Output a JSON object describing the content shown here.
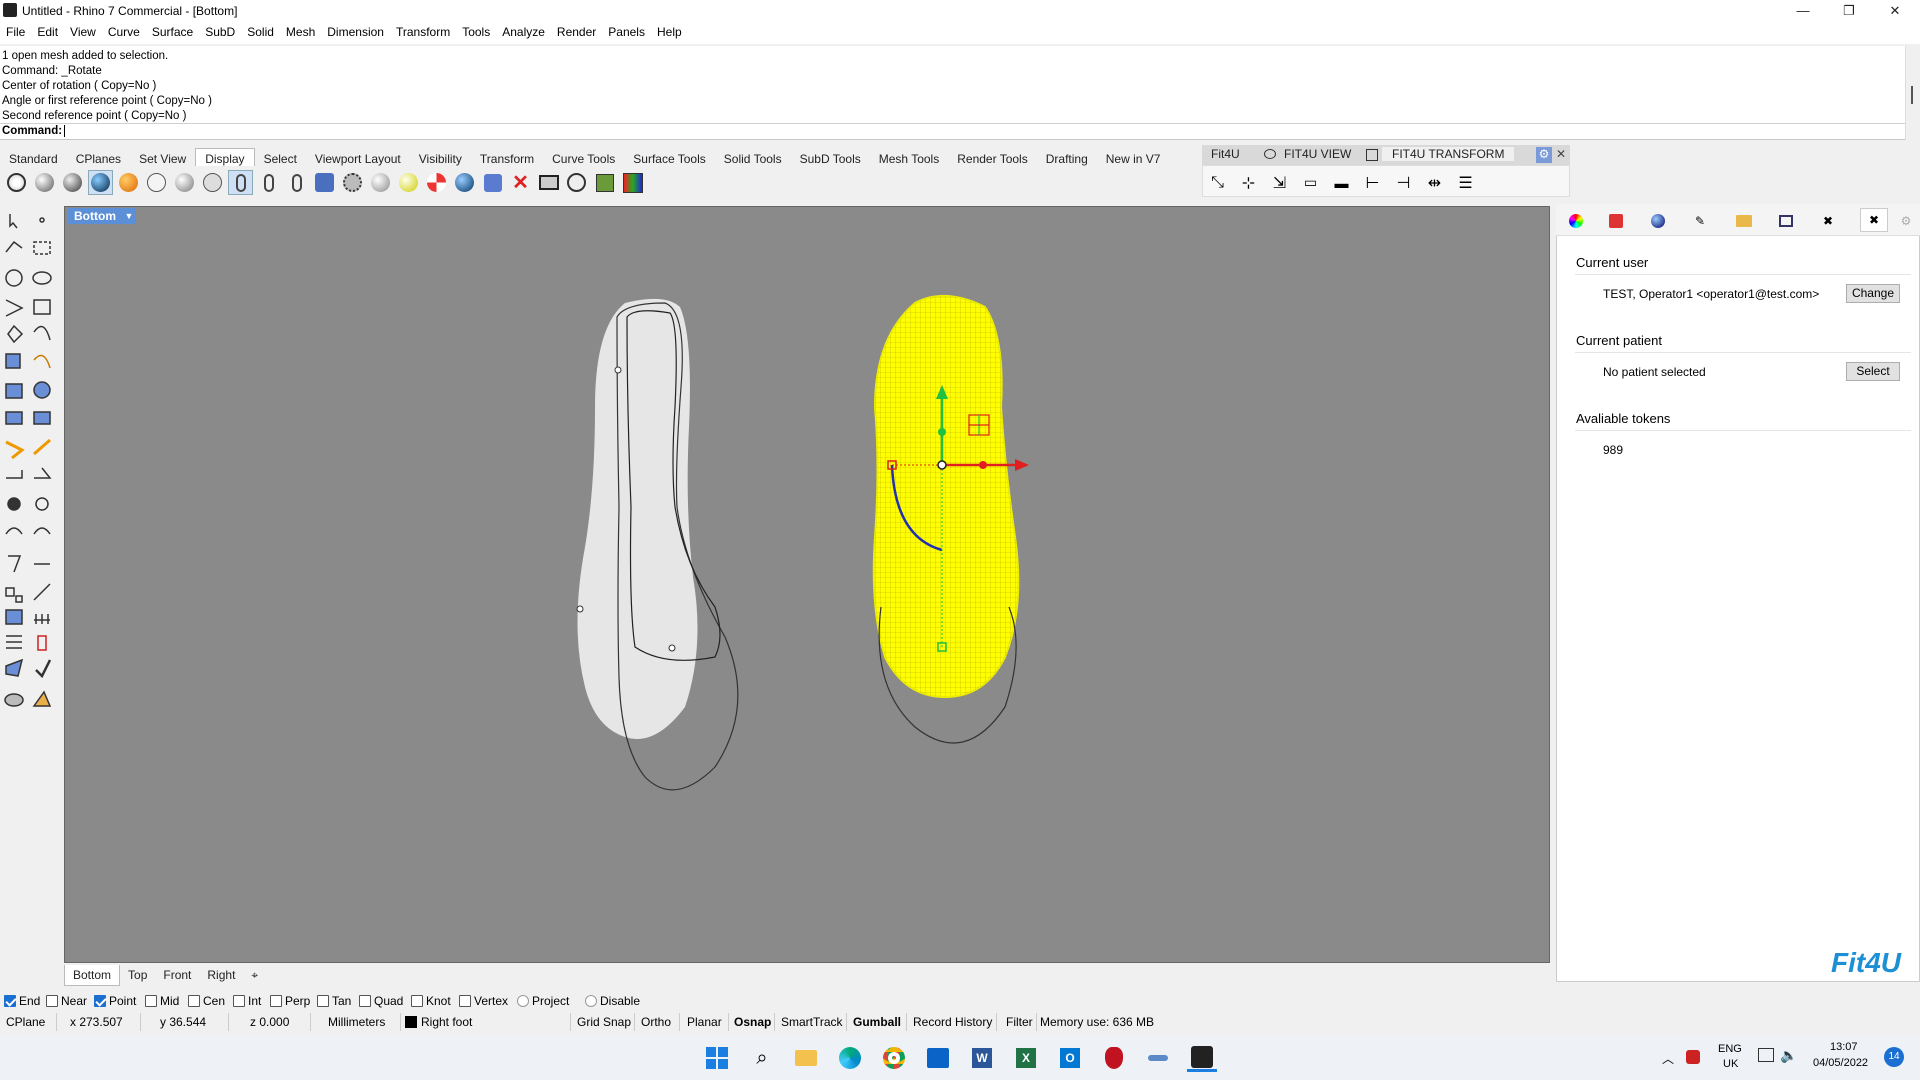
{
  "window": {
    "title": "Untitled - Rhino 7 Commercial - [Bottom]",
    "min": "—",
    "max": "❐",
    "close": "✕"
  },
  "menu": [
    "File",
    "Edit",
    "View",
    "Curve",
    "Surface",
    "SubD",
    "Solid",
    "Mesh",
    "Dimension",
    "Transform",
    "Tools",
    "Analyze",
    "Render",
    "Panels",
    "Help"
  ],
  "history": [
    "1 open mesh added to selection.",
    "Command: _Rotate",
    "Center of rotation ( Copy=No )",
    "Angle or first reference point ( Copy=No )",
    "Second reference point ( Copy=No )"
  ],
  "command": {
    "label": "Command:",
    "value": ""
  },
  "toolbar_tabs": [
    "Standard",
    "CPlanes",
    "Set View",
    "Display",
    "Select",
    "Viewport Layout",
    "Visibility",
    "Transform",
    "Curve Tools",
    "Surface Tools",
    "Solid Tools",
    "SubD Tools",
    "Mesh Tools",
    "Render Tools",
    "Drafting",
    "New in V7"
  ],
  "active_toolbar_tab": "Display",
  "fit4u_tabs": [
    "Fit4U",
    "FIT4U VIEW",
    "FIT4U TRANSFORM"
  ],
  "viewport": {
    "title": "Bottom",
    "tabs": [
      "Bottom",
      "Top",
      "Front",
      "Right"
    ],
    "active_tab": "Bottom",
    "add_tab": "⌖"
  },
  "panel": {
    "current_user_heading": "Current user",
    "current_user_value": "TEST, Operator1 <operator1@test.com>",
    "change_button": "Change",
    "current_patient_heading": "Current patient",
    "current_patient_value": "No patient selected",
    "select_button": "Select",
    "tokens_heading": "Avaliable tokens",
    "tokens_value": "989",
    "logo": "Fit4U"
  },
  "osnaps": [
    {
      "label": "End",
      "checked": true
    },
    {
      "label": "Near",
      "checked": false
    },
    {
      "label": "Point",
      "checked": true
    },
    {
      "label": "Mid",
      "checked": false
    },
    {
      "label": "Cen",
      "checked": false
    },
    {
      "label": "Int",
      "checked": false
    },
    {
      "label": "Perp",
      "checked": false
    },
    {
      "label": "Tan",
      "checked": false
    },
    {
      "label": "Quad",
      "checked": false
    },
    {
      "label": "Knot",
      "checked": false
    },
    {
      "label": "Vertex",
      "checked": false
    },
    {
      "label": "Project",
      "checked": false
    },
    {
      "label": "Disable",
      "checked": false
    }
  ],
  "status": {
    "cplane": "CPlane",
    "x": "x 273.507",
    "y": "y 36.544",
    "z": "z 0.000",
    "units": "Millimeters",
    "layer": "Right foot",
    "layer_color": "#000000",
    "grid_snap": "Grid Snap",
    "ortho": "Ortho",
    "planar": "Planar",
    "osnap": "Osnap",
    "smarttrack": "SmartTrack",
    "gumball": "Gumball",
    "record_history": "Record History",
    "filter": "Filter",
    "memory": "Memory use: 636 MB"
  },
  "taskbar": {
    "lang1": "ENG",
    "lang2": "UK",
    "time": "13:07",
    "date": "04/05/2022",
    "notifications": "14"
  },
  "colors": {
    "accent": "#5b8fd8",
    "mesh_selected": "#ffff00",
    "viewport_bg": "#8a8a8a",
    "gumball_x": "#e02020",
    "gumball_y": "#20c040",
    "gumball_rot": "#2030b0"
  }
}
